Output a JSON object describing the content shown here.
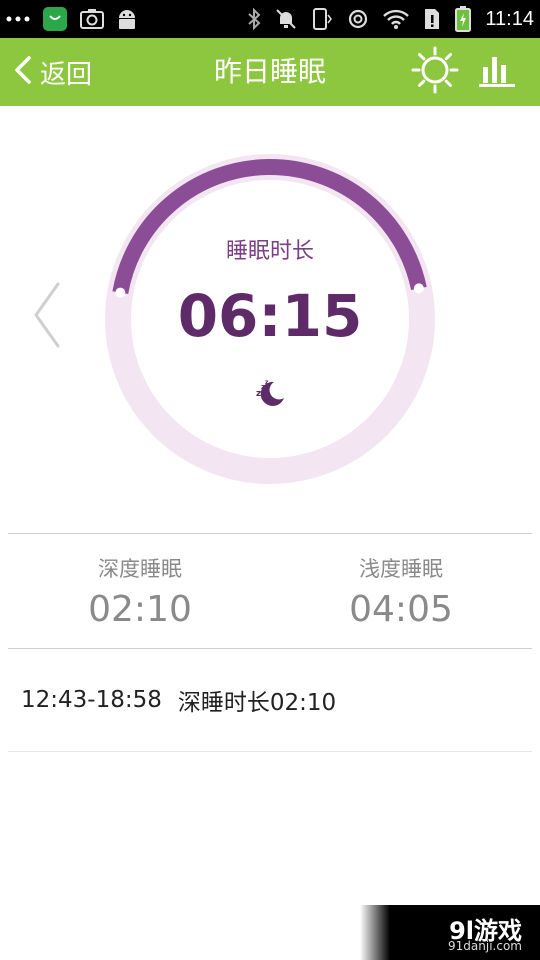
{
  "status_bar": {
    "time": "11:14",
    "icons": [
      "overflow-dots-icon",
      "shopping-bag-icon",
      "screenshot-icon",
      "android-icon",
      "bluetooth-icon",
      "mute-icon",
      "vibrate-icon",
      "sync-icon",
      "wifi-icon",
      "sim-alert-icon",
      "battery-charging-icon"
    ]
  },
  "header": {
    "back_label": "返回",
    "title": "昨日睡眠",
    "icons": [
      "sun-icon",
      "bar-chart-icon"
    ]
  },
  "ring": {
    "label": "睡眠时长",
    "value": "06:15",
    "progress_fraction": 0.44
  },
  "stats": {
    "deep": {
      "label": "深度睡眠",
      "value": "02:10"
    },
    "light": {
      "label": "浅度睡眠",
      "value": "04:05"
    }
  },
  "records": [
    {
      "time": "12:43-18:58",
      "desc": "深睡时长02:10"
    }
  ],
  "watermark": {
    "brand": "9l游戏",
    "url": "91danji.com"
  },
  "colors": {
    "header_bg": "#8dc63f",
    "ring_track": "#f3e6f2",
    "ring_progress": "#8b4e96",
    "value_text": "#5e2a68",
    "stat_text": "#8a8a8a"
  }
}
